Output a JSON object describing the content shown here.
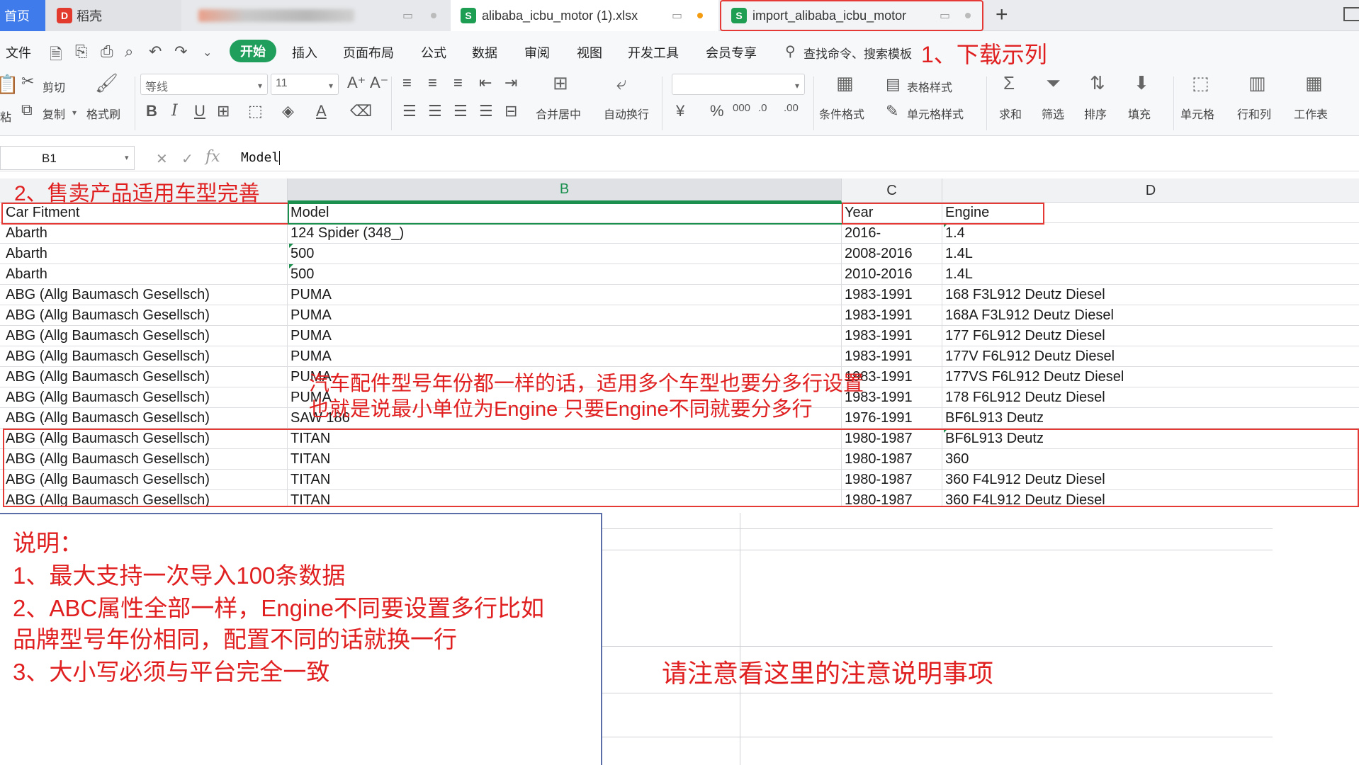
{
  "tabs": {
    "home": "首页",
    "daoke": "稻壳",
    "file1": "alibaba_icbu_motor (1).xlsx",
    "file2": "import_alibaba_icbu_motor"
  },
  "menu": {
    "file": "文件",
    "start": "开始",
    "insert": "插入",
    "layout": "页面布局",
    "formula": "公式",
    "data": "数据",
    "review": "审阅",
    "view": "视图",
    "dev": "开发工具",
    "member": "会员专享",
    "search": "查找命令、搜索模板"
  },
  "ribbon": {
    "cut": "剪切",
    "paste": "粘",
    "copy": "复制",
    "format_painter": "格式刷",
    "font_name": "等线",
    "font_size": "11",
    "merge": "合并居中",
    "wrap": "自动换行",
    "conditional": "条件格式",
    "table_style": "表格样式",
    "cell_style": "单元格样式",
    "sum": "求和",
    "filter": "筛选",
    "sort": "排序",
    "fill": "填充",
    "cell": "单元格",
    "row_col": "行和列",
    "worksheet": "工作表"
  },
  "formula_bar": {
    "cell_ref": "B1",
    "value": "Model"
  },
  "columns": [
    "B",
    "C",
    "D"
  ],
  "sheet": {
    "header": [
      "Car Fitment",
      "Model",
      "Year",
      "Engine"
    ],
    "rows": [
      [
        "Abarth",
        "124 Spider (348_)",
        "2016-",
        "1.4"
      ],
      [
        "Abarth",
        "500",
        "2008-2016",
        "1.4L"
      ],
      [
        "Abarth",
        "500",
        "2010-2016",
        "1.4L"
      ],
      [
        "ABG (Allg Baumasch Gesellsch)",
        "PUMA",
        "1983-1991",
        "168 F3L912 Deutz Diesel"
      ],
      [
        "ABG (Allg Baumasch Gesellsch)",
        "PUMA",
        "1983-1991",
        "168A F3L912 Deutz Diesel"
      ],
      [
        "ABG (Allg Baumasch Gesellsch)",
        "PUMA",
        "1983-1991",
        "177 F6L912 Deutz Diesel"
      ],
      [
        "ABG (Allg Baumasch Gesellsch)",
        "PUMA",
        "1983-1991",
        "177V F6L912 Deutz Diesel"
      ],
      [
        "ABG (Allg Baumasch Gesellsch)",
        "PUMA",
        "1983-1991",
        "177VS F6L912 Deutz Diesel"
      ],
      [
        "ABG (Allg Baumasch Gesellsch)",
        "PUMA",
        "1983-1991",
        "178 F6L912 Deutz Diesel"
      ],
      [
        "ABG (Allg Baumasch Gesellsch)",
        "SAW 186",
        "1976-1991",
        "BF6L913 Deutz"
      ],
      [
        "ABG (Allg Baumasch Gesellsch)",
        "TITAN",
        "1980-1987",
        "BF6L913 Deutz"
      ],
      [
        "ABG (Allg Baumasch Gesellsch)",
        "TITAN",
        "1980-1987",
        "360"
      ],
      [
        "ABG (Allg Baumasch Gesellsch)",
        "TITAN",
        "1980-1987",
        "360 F4L912 Deutz Diesel"
      ],
      [
        "ABG (Allg Baumasch Gesellsch)",
        "TITAN",
        "1980-1987",
        "360 F4L912 Deutz Diesel"
      ]
    ]
  },
  "annotations": {
    "download": "1、下载示列",
    "fitment": "2、售卖产品适用车型完善",
    "overlay1": "汽车配件型号年份都一样的话，适用多个车型也要分多行设置",
    "overlay2": "也就是说最小单位为Engine 只要Engine不同就要分多行",
    "notice": "请注意看这里的注意说明事项"
  },
  "notes": {
    "title": "说明：",
    "line1": "1、最大支持一次导入100条数据",
    "line2": "2、ABC属性全部一样，Engine不同要设置多行比如",
    "line3": "品牌型号年份相同，配置不同的话就换一行",
    "line4": "3、大小写必须与平台完全一致"
  },
  "colors": {
    "accent_green": "#1f9e5c",
    "annotation_red": "#e02020"
  }
}
